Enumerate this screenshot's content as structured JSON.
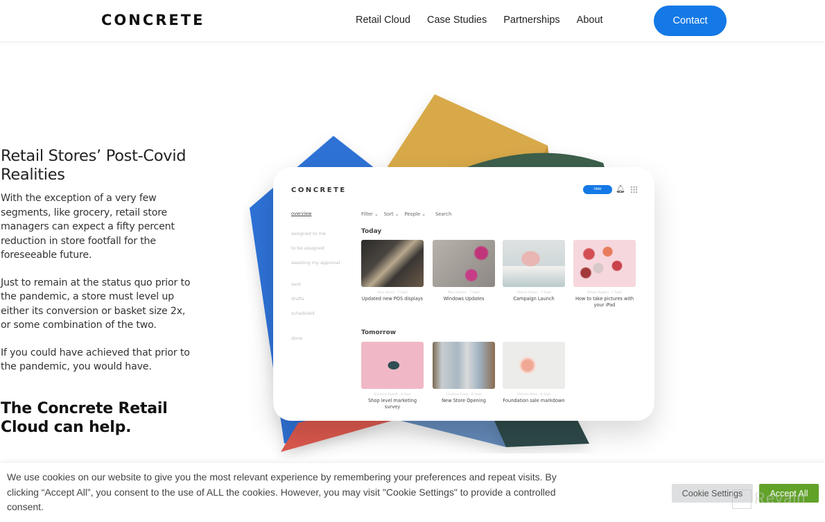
{
  "header": {
    "logo": "CONCRETE",
    "nav": [
      "Retail Cloud",
      "Case Studies",
      "Partnerships",
      "About"
    ],
    "contact_label": "Contact"
  },
  "main": {
    "heading": "Retail Stores’ Post-Covid Realities",
    "paragraphs": [
      "With the exception of a very few segments, like grocery, retail store managers can expect a fifty percent reduction in store footfall for the foreseeable future.",
      "Just to remain at the status quo prior to the pandemic, a store must level up either its conversion or basket size 2x, or some combination of the two.",
      "If you could have achieved that prior to the pandemic, you would have."
    ],
    "cta_heading": "The Concrete Retail Cloud can help."
  },
  "tablet": {
    "logo": "CONCRETE",
    "new_label": "new",
    "sidebar": [
      "overview",
      "assigned to me",
      "to be assigned",
      "awaiting my approval",
      "sent",
      "drafts",
      "scheduled",
      "done"
    ],
    "filters": [
      "Filter ⌄",
      "Sort ⌄",
      "People ⌄",
      "Search"
    ],
    "sections": [
      {
        "label": "Today",
        "cards": [
          {
            "meta": "Alex Harris · 7 Sept",
            "title": "Updated new POS displays"
          },
          {
            "meta": "Max Farmer · 7 Sept",
            "title": "Windows Updates"
          },
          {
            "meta": "Tawnie Rosen · 7 Sept",
            "title": "Campaign Launch"
          },
          {
            "meta": "Tomas Rogers · 7 Sept",
            "title": "How to take pictures with your iPad"
          }
        ]
      },
      {
        "label": "Tomorrow",
        "cards": [
          {
            "meta": "Vivienne Roselt · 8 Sept",
            "title": "Shop level marketing survey"
          },
          {
            "meta": "Chelsea Frank · 8 Sept",
            "title": "New Store Opening"
          },
          {
            "meta": "Victoria Allen · 8 Sept",
            "title": "Foundation sale markdown"
          }
        ]
      }
    ]
  },
  "cookie": {
    "text": "We use cookies on our website to give you the most relevant experience by remembering your preferences and repeat visits. By clicking “Accept All”, you consent to the use of ALL the cookies. However, you may visit \"Cookie Settings\" to provide a controlled consent.",
    "settings_label": "Cookie Settings",
    "accept_label": "Accept All",
    "watermark": "Revain"
  },
  "colors": {
    "accent": "#1479e6",
    "accept": "#61a229"
  }
}
